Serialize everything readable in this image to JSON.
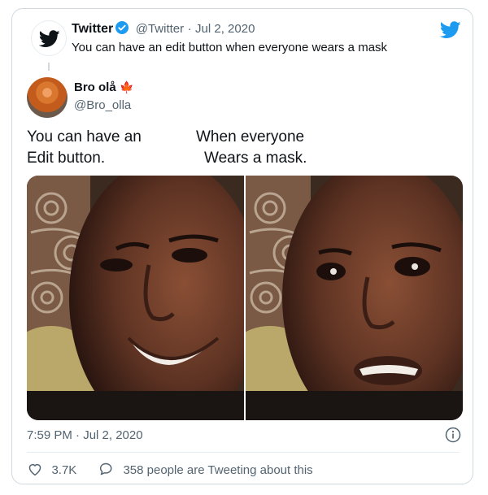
{
  "tweet": {
    "author_name": "Twitter",
    "author_handle": "@Twitter",
    "separator": "·",
    "date": "Jul 2, 2020",
    "text": "You can have an edit button when everyone wears a mask",
    "timestamp": "7:59 PM · Jul 2, 2020"
  },
  "quoted": {
    "author_name": "Bro olå",
    "author_flag": "🍁",
    "author_handle": "@Bro_olla",
    "caption_left_line1": "You can have an",
    "caption_left_line2": "Edit button.",
    "caption_right_line1": "When everyone",
    "caption_right_line2": "Wears a mask."
  },
  "stats": {
    "likes": "3.7K",
    "tweeting": "358 people are Tweeting about this"
  },
  "colors": {
    "twitter_blue": "#1d9bf0",
    "text_primary": "#0f1419",
    "text_muted": "#536471",
    "border": "#cfd9de",
    "flag_red": "#e0245e"
  },
  "icons": {
    "brand": "twitter-bird-icon",
    "verified": "verified-badge-icon",
    "info": "info-icon",
    "like": "heart-icon",
    "reply": "speech-bubble-icon"
  }
}
